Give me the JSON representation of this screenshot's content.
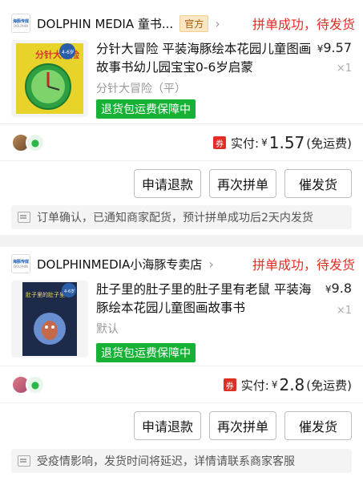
{
  "orders": [
    {
      "shop": {
        "name": "DOLPHIN MEDIA 童书...",
        "tag": "官方",
        "status": "拼单成功，待发货",
        "logo_line1": "海豚传媒",
        "logo_line2": "DOLPHIN"
      },
      "goods": {
        "title": "分针大冒险 平装海豚绘本花园儿童图画故事书幼儿园宝宝0-6岁启蒙",
        "spec": "分针大冒险（平）",
        "badge": "退货包运费保障中",
        "currency": "¥",
        "price": "9.57",
        "qty": "×1",
        "cover_title": "分针大冒险",
        "cover_sticker": "4-6岁"
      },
      "payment": {
        "coupon": "券",
        "label": "实付:",
        "currency": "¥",
        "amount": "1.57",
        "note": "(免运费)"
      },
      "buttons": {
        "refund": "申请退款",
        "regroup": "再次拼单",
        "urge": "催发货"
      },
      "notice": "订单确认，已通知商家配货，预计拼单成功后2天内发货"
    },
    {
      "shop": {
        "name": "DOLPHINMEDIA小海豚专卖店",
        "tag": "",
        "status": "拼单成功，待发货",
        "logo_line1": "海豚传媒",
        "logo_line2": "DOLPHIN"
      },
      "goods": {
        "title": "肚子里的肚子里的肚子里有老鼠 平装海豚绘本花园儿童图画故事书",
        "spec": "默认",
        "badge": "退货包运费保障中",
        "currency": "¥",
        "price": "9.8",
        "qty": "×1",
        "cover_title": "肚子里的肚子里",
        "cover_sticker": "4-6岁"
      },
      "payment": {
        "coupon": "券",
        "label": "实付:",
        "currency": "¥",
        "amount": "2.8",
        "note": "(免运费)"
      },
      "buttons": {
        "refund": "申请退款",
        "regroup": "再次拼单",
        "urge": "催发货"
      },
      "notice": "受疫情影响，发货时间将延迟，详情请联系商家客服"
    }
  ],
  "colors": {
    "accent": "#e02e24",
    "badge_green": "#17b135",
    "cover1": "#e8d32a",
    "cover2": "#1d2a4a"
  }
}
